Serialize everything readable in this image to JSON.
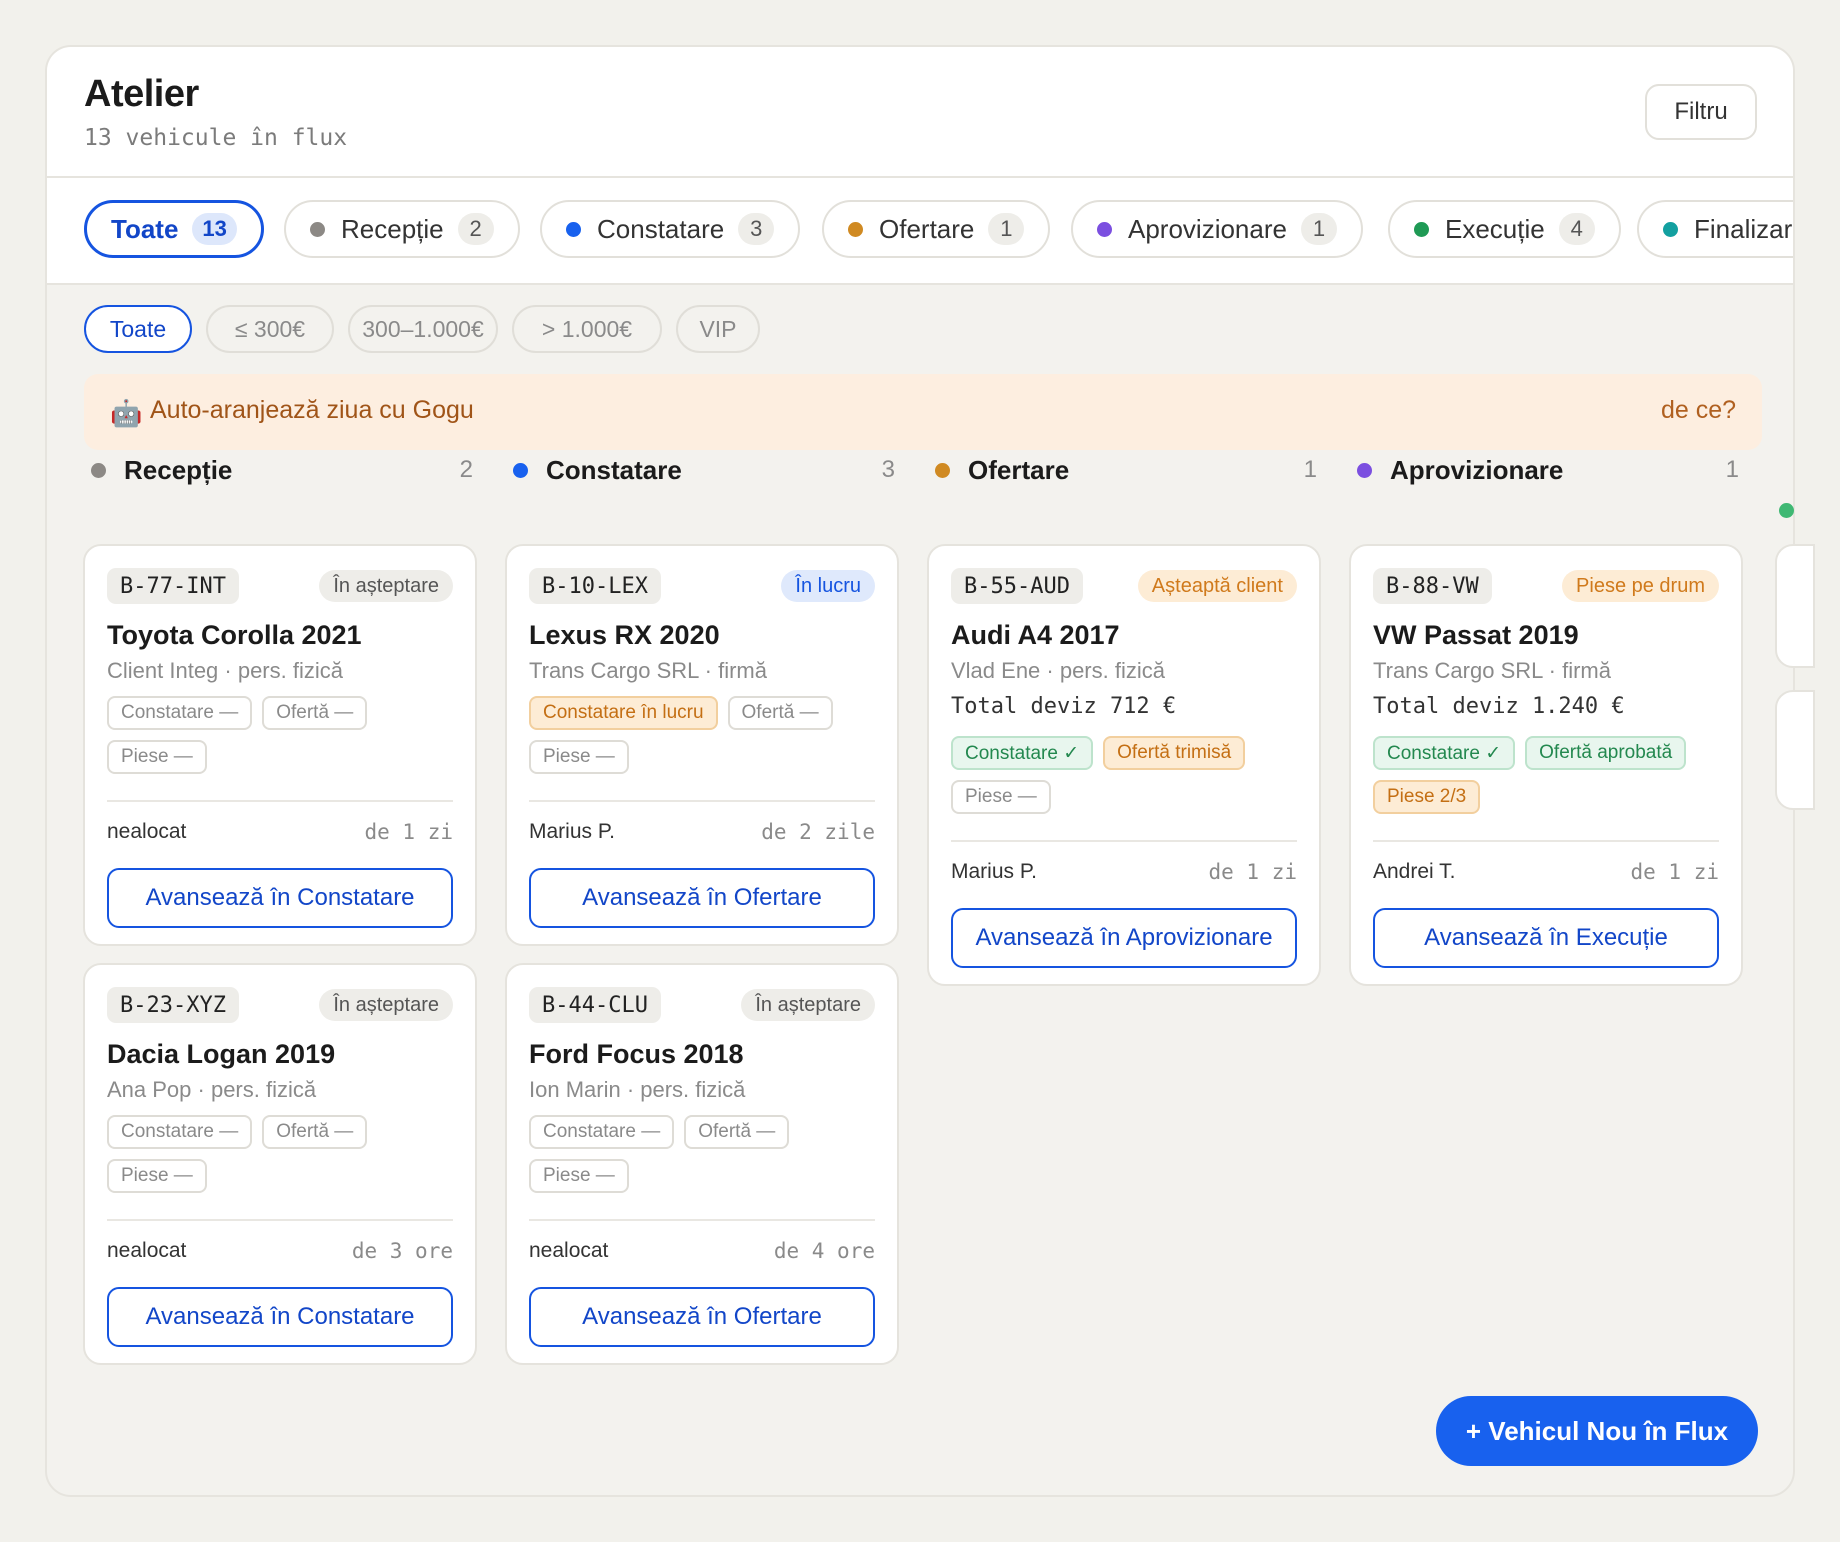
{
  "header": {
    "title": "Atelier",
    "subtitle": "13 vehicule în flux",
    "filter_label": "Filtru"
  },
  "tabs": [
    {
      "label": "Toate",
      "count": "13",
      "color": ""
    },
    {
      "label": "Recepție",
      "count": "2",
      "color": "#8c8985"
    },
    {
      "label": "Constatare",
      "count": "3",
      "color": "#1861ee"
    },
    {
      "label": "Ofertare",
      "count": "1",
      "color": "#d08a22"
    },
    {
      "label": "Aprovizionare",
      "count": "1",
      "color": "#7b4fe0"
    },
    {
      "label": "Execuție",
      "count": "4",
      "color": "#1f9a55"
    },
    {
      "label": "Finalizare",
      "count": "",
      "color": "#13a0a0"
    }
  ],
  "price_filters": [
    "Toate",
    "≤ 300€",
    "300–1.000€",
    "> 1.000€",
    "VIP"
  ],
  "banner": {
    "icon": "robot-icon",
    "icon_glyph": "🤖",
    "text": "Auto-aranjează ziua cu Gogu",
    "link": "de ce?"
  },
  "columns": [
    {
      "name": "Recepție",
      "count": "2",
      "color": "#8c8985",
      "cards": [
        {
          "plate": "B-77-INT",
          "status": "În așteptare",
          "status_type": "wait",
          "car": "Toyota Corolla 2021",
          "client": "Client Integ · pers. fizică",
          "total": "",
          "tags": [
            {
              "t": "Constatare —",
              "k": ""
            },
            {
              "t": "Ofertă —",
              "k": ""
            },
            {
              "t": "Piese —",
              "k": ""
            }
          ],
          "owner": "nealocat",
          "when": "de 1 zi",
          "action": "Avansează în Constatare"
        },
        {
          "plate": "B-23-XYZ",
          "status": "În așteptare",
          "status_type": "wait",
          "car": "Dacia Logan 2019",
          "client": "Ana Pop · pers. fizică",
          "total": "",
          "tags": [
            {
              "t": "Constatare —",
              "k": ""
            },
            {
              "t": "Ofertă —",
              "k": ""
            },
            {
              "t": "Piese —",
              "k": ""
            }
          ],
          "owner": "nealocat",
          "when": "de 3 ore",
          "action": "Avansează în Constatare"
        }
      ]
    },
    {
      "name": "Constatare",
      "count": "3",
      "color": "#1861ee",
      "cards": [
        {
          "plate": "B-10-LEX",
          "status": "În lucru",
          "status_type": "work",
          "car": "Lexus RX 2020",
          "client": "Trans Cargo SRL · firmă",
          "total": "",
          "tags": [
            {
              "t": "Constatare în lucru",
              "k": "warn"
            },
            {
              "t": "Ofertă —",
              "k": ""
            },
            {
              "t": "Piese —",
              "k": ""
            }
          ],
          "owner": "Marius P.",
          "when": "de 2 zile",
          "action": "Avansează în Ofertare"
        },
        {
          "plate": "B-44-CLU",
          "status": "În așteptare",
          "status_type": "wait",
          "car": "Ford Focus 2018",
          "client": "Ion Marin · pers. fizică",
          "total": "",
          "tags": [
            {
              "t": "Constatare —",
              "k": ""
            },
            {
              "t": "Ofertă —",
              "k": ""
            },
            {
              "t": "Piese —",
              "k": ""
            }
          ],
          "owner": "nealocat",
          "when": "de 4 ore",
          "action": "Avansează în Ofertare"
        }
      ]
    },
    {
      "name": "Ofertare",
      "count": "1",
      "color": "#d08a22",
      "cards": [
        {
          "plate": "B-55-AUD",
          "status": "Așteaptă client",
          "status_type": "client",
          "car": "Audi A4 2017",
          "client": "Vlad Ene · pers. fizică",
          "total": "Total deviz 712 €",
          "tags": [
            {
              "t": "Constatare ✓",
              "k": "ok"
            },
            {
              "t": "Ofertă trimisă",
              "k": "warn"
            },
            {
              "t": "Piese —",
              "k": ""
            }
          ],
          "owner": "Marius P.",
          "when": "de 1 zi",
          "action": "Avansează în Aprovizionare"
        }
      ]
    },
    {
      "name": "Aprovizionare",
      "count": "1",
      "color": "#7b4fe0",
      "cards": [
        {
          "plate": "B-88-VW",
          "status": "Piese pe drum",
          "status_type": "road",
          "car": "VW Passat 2019",
          "client": "Trans Cargo SRL · firmă",
          "total": "Total deviz 1.240 €",
          "tags": [
            {
              "t": "Constatare ✓",
              "k": "ok"
            },
            {
              "t": "Ofertă aprobată",
              "k": "ok"
            },
            {
              "t": "Piese 2/3",
              "k": "warn"
            }
          ],
          "owner": "Andrei T.",
          "when": "de 1 zi",
          "action": "Avansează în Execuție"
        }
      ]
    }
  ],
  "next_column_color": "#3fb873",
  "fab_label": "+ Vehicul Nou în Flux"
}
